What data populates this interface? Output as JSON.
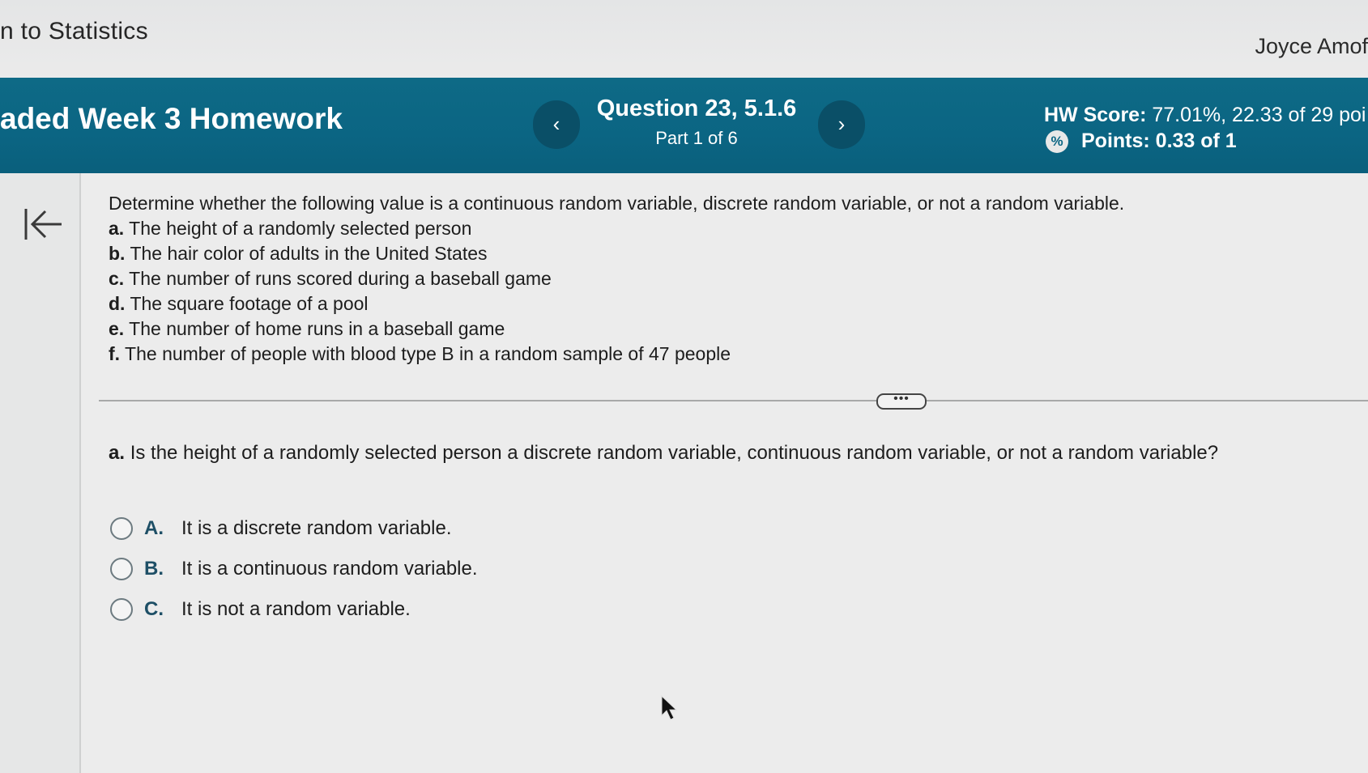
{
  "topbar": {
    "course_title": "n to Statistics",
    "user_name": "Joyce Amof"
  },
  "header": {
    "assignment_title": "aded Week 3 Homework",
    "prev_label": "‹",
    "next_label": "›",
    "question_id": "Question 23, 5.1.6",
    "part_label": "Part 1 of 6",
    "hw_score_label": "HW Score:",
    "hw_score_value": "77.01%, 22.33 of 29 poi",
    "points_label": "Points: 0.33 of 1",
    "points_icon": "%"
  },
  "question": {
    "intro": "Determine whether the following value is a continuous random variable, discrete random variable, or not a random variable.",
    "items": [
      {
        "letter": "a.",
        "text": "The height of a randomly selected person"
      },
      {
        "letter": "b.",
        "text": "The hair color of adults in the United States"
      },
      {
        "letter": "c.",
        "text": "The number of runs scored during a baseball game"
      },
      {
        "letter": "d.",
        "text": "The square footage of a pool"
      },
      {
        "letter": "e.",
        "text": "The number of home runs in a baseball game"
      },
      {
        "letter": "f.",
        "text": "The number of people with blood type B in a random sample of 47 people"
      }
    ],
    "ellipsis": "•••",
    "sub_letter": "a.",
    "sub_text": "Is the height of a randomly selected person a discrete random variable, continuous random variable, or not a random variable?",
    "choices": [
      {
        "letter": "A.",
        "text": "It is a discrete random variable."
      },
      {
        "letter": "B.",
        "text": "It is a continuous random variable."
      },
      {
        "letter": "C.",
        "text": "It is not a random variable."
      }
    ]
  },
  "colors": {
    "header_bg": "#0b6583",
    "nav_button_bg": "#0a4f67",
    "choice_letter": "#1e4f66"
  }
}
